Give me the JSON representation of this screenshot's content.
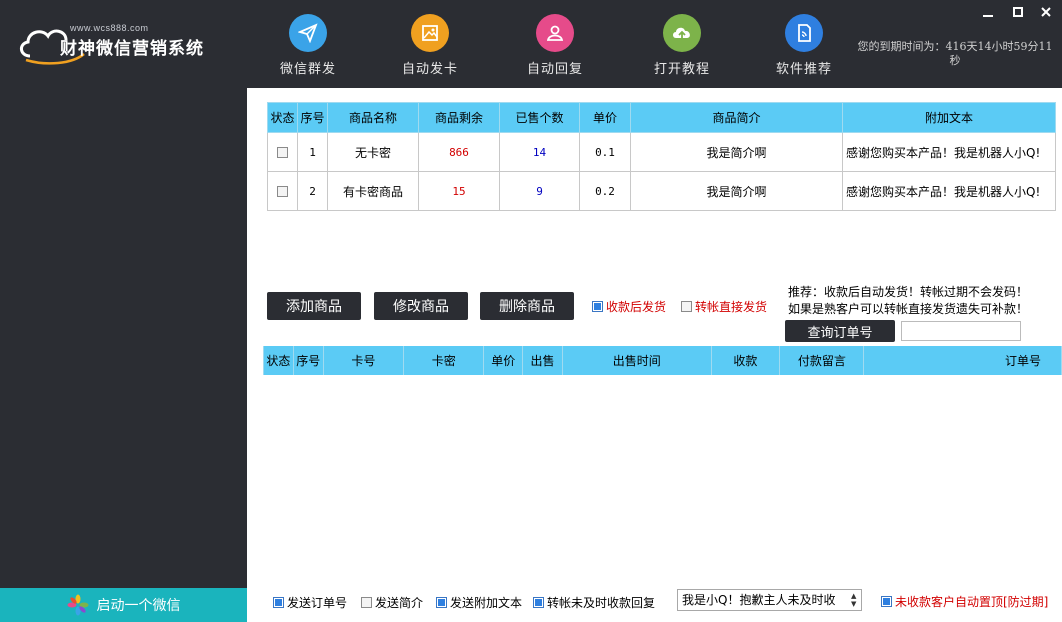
{
  "header": {
    "logo_url": "www.wcs888.com",
    "app_title": "财神微信营销系统",
    "expire_text": "您的到期时间为：416天14小时59分11秒",
    "nav": [
      {
        "label": "微信群发",
        "icon": "paper-plane-icon",
        "color": "#3aa3e8"
      },
      {
        "label": "自动发卡",
        "icon": "image-card-icon",
        "color": "#f0a020"
      },
      {
        "label": "自动回复",
        "icon": "user-icon",
        "color": "#e64b8a"
      },
      {
        "label": "打开教程",
        "icon": "cloud-upload-icon",
        "color": "#7db34a"
      },
      {
        "label": "软件推荐",
        "icon": "document-icon",
        "color": "#2f7fe0"
      }
    ]
  },
  "sidebar": {
    "start_label": "启动一个微信"
  },
  "products": {
    "columns": [
      "状态",
      "序号",
      "商品名称",
      "商品剩余",
      "已售个数",
      "单价",
      "商品简介",
      "附加文本"
    ],
    "rows": [
      {
        "no": "1",
        "name": "无卡密",
        "remain": "866",
        "sold": "14",
        "price": "0.1",
        "intro": "我是简介啊",
        "extra": "感谢您购买本产品！我是机器人小Q!"
      },
      {
        "no": "2",
        "name": "有卡密商品",
        "remain": "15",
        "sold": "9",
        "price": "0.2",
        "intro": "我是简介啊",
        "extra": "感谢您购买本产品！我是机器人小Q!"
      }
    ]
  },
  "actions": {
    "add": "添加商品",
    "edit": "修改商品",
    "delete": "删除商品",
    "ship_after_pay": "收款后发货",
    "ship_on_transfer": "转帐直接发货",
    "hint1": "推荐：收款后自动发货！转帐过期不会发码！",
    "hint2": "如果是熟客户可以转帐直接发货遗失可补款！",
    "query_order": "查询订单号"
  },
  "orders": {
    "columns": [
      "状态",
      "序号",
      "卡号",
      "卡密",
      "单价",
      "出售",
      "出售时间",
      "收款",
      "付款留言",
      "订单号"
    ]
  },
  "bottom": {
    "send_order_no": "发送订单号",
    "send_intro": "发送简介",
    "send_extra": "发送附加文本",
    "late_reply": "转帐未及时收款回复",
    "reply_text": "我是小Q！抱歉主人未及时收",
    "pin_unpaid": "未收款客户自动置顶[防过期]"
  }
}
